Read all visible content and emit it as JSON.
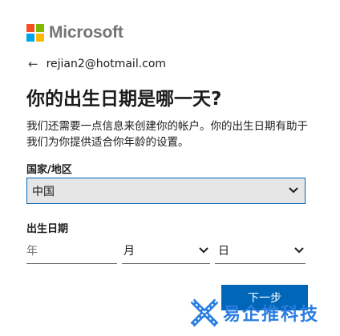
{
  "brand": {
    "name": "Microsoft"
  },
  "identity": {
    "back_icon": "←",
    "email": "rejian2@hotmail.com"
  },
  "page": {
    "title": "你的出生日期是哪一天?",
    "description": "我们还需要一点信息来创建你的帐户。你的出生日期有助于我们为你提供适合你年龄的设置。"
  },
  "country": {
    "label": "国家/地区",
    "value": "中国",
    "chevron": "⌄"
  },
  "birthdate": {
    "label": "出生日期",
    "year_placeholder": "年",
    "month_value": "月",
    "day_value": "日",
    "chevron": "⌄"
  },
  "actions": {
    "next_label": "下一步"
  },
  "watermark": {
    "text": "易企推科技"
  },
  "colors": {
    "accent": "#0067b8",
    "field_bg": "#e6e6e6"
  }
}
